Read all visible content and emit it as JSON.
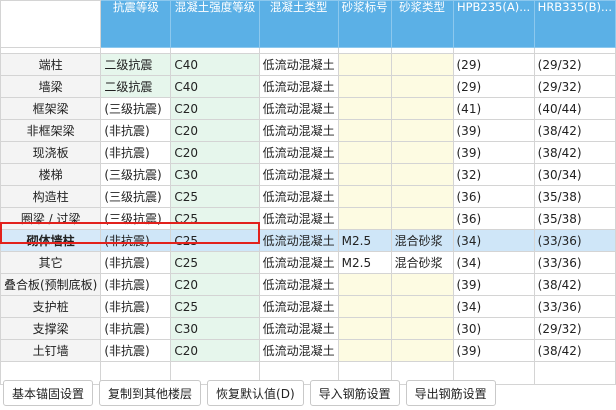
{
  "headers": [
    "抗震等级",
    "混凝土强度等级",
    "混凝土类型",
    "砂浆标号",
    "砂浆类型",
    "HPB235(A)...",
    "HRB335(B)..."
  ],
  "rows": [
    {
      "name": "端柱",
      "seismic": "二级抗震",
      "grade": "C40",
      "ctype": "低流动混凝土",
      "mortar": "",
      "mtype": "",
      "a": "(29)",
      "b": "(29/32)"
    },
    {
      "name": "墙梁",
      "seismic": "二级抗震",
      "grade": "C40",
      "ctype": "低流动混凝土",
      "mortar": "",
      "mtype": "",
      "a": "(29)",
      "b": "(29/32)"
    },
    {
      "name": "框架梁",
      "seismic": "(三级抗震)",
      "grade": "C20",
      "ctype": "低流动混凝土",
      "mortar": "",
      "mtype": "",
      "a": "(41)",
      "b": "(40/44)"
    },
    {
      "name": "非框架梁",
      "seismic": "(非抗震)",
      "grade": "C20",
      "ctype": "低流动混凝土",
      "mortar": "",
      "mtype": "",
      "a": "(39)",
      "b": "(38/42)"
    },
    {
      "name": "现浇板",
      "seismic": "(非抗震)",
      "grade": "C20",
      "ctype": "低流动混凝土",
      "mortar": "",
      "mtype": "",
      "a": "(39)",
      "b": "(38/42)"
    },
    {
      "name": "楼梯",
      "seismic": "(三级抗震)",
      "grade": "C30",
      "ctype": "低流动混凝土",
      "mortar": "",
      "mtype": "",
      "a": "(32)",
      "b": "(30/34)"
    },
    {
      "name": "构造柱",
      "seismic": "(三级抗震)",
      "grade": "C25",
      "ctype": "低流动混凝土",
      "mortar": "",
      "mtype": "",
      "a": "(36)",
      "b": "(35/38)"
    },
    {
      "name": "圈梁 / 过梁",
      "seismic": "(三级抗震)",
      "grade": "C25",
      "ctype": "低流动混凝土",
      "mortar": "",
      "mtype": "",
      "a": "(36)",
      "b": "(35/38)"
    },
    {
      "name": "砌体墙柱",
      "seismic": "(非抗震)",
      "grade": "C25",
      "ctype": "低流动混凝土",
      "mortar": "M2.5",
      "mtype": "混合砂浆",
      "a": "(34)",
      "b": "(33/36)"
    },
    {
      "name": "其它",
      "seismic": "(非抗震)",
      "grade": "C25",
      "ctype": "低流动混凝土",
      "mortar": "M2.5",
      "mtype": "混合砂浆",
      "a": "(34)",
      "b": "(33/36)"
    },
    {
      "name": "叠合板(预制底板)",
      "seismic": "(非抗震)",
      "grade": "C20",
      "ctype": "低流动混凝土",
      "mortar": "",
      "mtype": "",
      "a": "(39)",
      "b": "(38/42)"
    },
    {
      "name": "支护桩",
      "seismic": "(非抗震)",
      "grade": "C25",
      "ctype": "低流动混凝土",
      "mortar": "",
      "mtype": "",
      "a": "(34)",
      "b": "(33/36)"
    },
    {
      "name": "支撑梁",
      "seismic": "(非抗震)",
      "grade": "C30",
      "ctype": "低流动混凝土",
      "mortar": "",
      "mtype": "",
      "a": "(30)",
      "b": "(29/32)"
    },
    {
      "name": "土钉墙",
      "seismic": "(非抗震)",
      "grade": "C20",
      "ctype": "低流动混凝土",
      "mortar": "",
      "mtype": "",
      "a": "(39)",
      "b": "(38/42)"
    }
  ],
  "selected_row": "砌体墙柱",
  "buttons": [
    "基本锚固设置",
    "复制到其他楼层",
    "恢复默认值(D)",
    "导入钢筋设置",
    "导出钢筋设置"
  ],
  "colors": {
    "header": "#5bb0e6",
    "selection": "#cfe6f8",
    "highlight_border": "#e2211c",
    "green_cell": "#e6f6ec",
    "yellow_cell": "#fdfbe2"
  }
}
